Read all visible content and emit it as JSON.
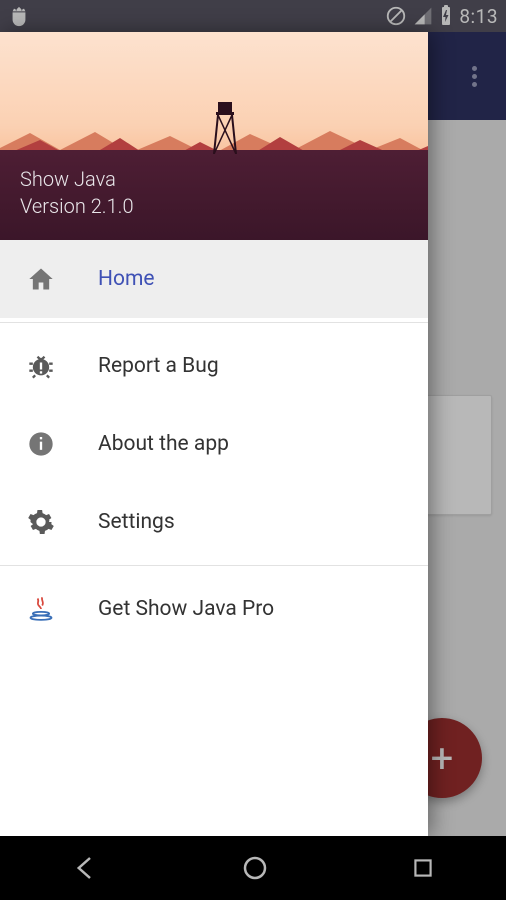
{
  "status": {
    "time": "8:13"
  },
  "drawer": {
    "title_line1": "Show Java",
    "title_line2": "Version 2.1.0",
    "items": [
      {
        "label": "Home",
        "active": true
      },
      {
        "label": "Report a Bug",
        "active": false
      },
      {
        "label": "About the app",
        "active": false
      },
      {
        "label": "Settings",
        "active": false
      },
      {
        "label": "Get Show Java Pro",
        "active": false
      }
    ]
  },
  "fab": {
    "label": "+"
  },
  "colors": {
    "accent": "#3f51b5",
    "fab": "#9b2e2e",
    "app_bar": "#2e3263"
  }
}
